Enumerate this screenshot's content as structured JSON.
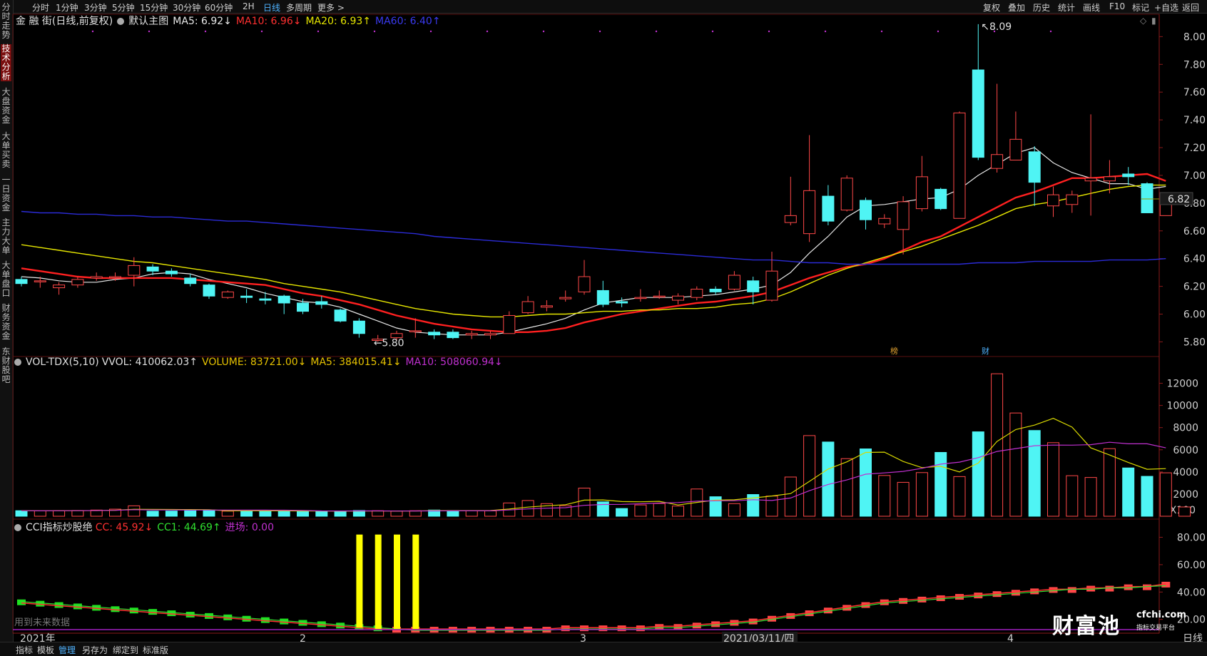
{
  "topbar": {
    "timeframes": [
      "分时",
      "1分钟",
      "3分钟",
      "5分钟",
      "15分钟",
      "30分钟",
      "60分钟",
      "2H",
      "日线",
      "多周期",
      "更多 >"
    ],
    "active_timeframe": "日线",
    "right_tools": [
      "复权",
      "叠加",
      "历史",
      "统计",
      "画线",
      "F10",
      "标记",
      "+自选",
      "返回"
    ]
  },
  "sidebar": {
    "items": [
      "分时走势",
      "技术分析",
      "大盘资金",
      "大单买卖",
      "一日资金",
      "主力大单",
      "大单盘口",
      "财务资金",
      "东财股吧"
    ],
    "active": "技术分析"
  },
  "main_header": {
    "title": "金 融 街(日线,前复权)",
    "template": "默认主图",
    "ma5": "MA5: 6.92↓",
    "ma10": "MA10: 6.96↓",
    "ma20": "MA20: 6.93↑",
    "ma60": "MA60: 6.40↑"
  },
  "vol_header": {
    "name": "VOL-TDX(5,10)",
    "vvol": "VVOL: 410062.03↑",
    "volume": "VOLUME: 83721.00↓",
    "ma5": "MA5: 384015.41↓",
    "ma10": "MA10: 508060.94↓"
  },
  "cci_header": {
    "name": "CCI指标炒股绝",
    "cc": "CC: 45.92↓",
    "cc1": "CC1: 44.69↑",
    "entry": "进场: 0.00"
  },
  "labels": {
    "high": "8.09",
    "low": "5.80",
    "last_price": "6.82",
    "unit": "X100",
    "future_note": "用到未来数据",
    "period": "日线",
    "marker_bang": "榜",
    "marker_cai": "财",
    "x_axis": [
      "2021年",
      "2",
      "3",
      "2021/03/11/四",
      "4"
    ]
  },
  "bottombar": {
    "items": [
      "指标",
      "模板",
      "管理",
      "另存为",
      "绑定到",
      "标准版"
    ],
    "active": "管理"
  },
  "watermark": {
    "brand": "财富池",
    "site": "cfchi.com",
    "tagline": "指标交易平台"
  },
  "colors": {
    "up": "#ff4848",
    "down": "#4ff4f4",
    "ma5": "#e8e8e8",
    "ma10": "#ff2020",
    "ma20": "#e6e600",
    "ma60": "#2b2bd6",
    "vol_ma5": "#d8d800",
    "vol_ma10": "#c030d0"
  },
  "chart_data": [
    {
      "type": "candlestick",
      "title": "金 融 街(日线,前复权)",
      "x_labels": [
        "2021年",
        "2",
        "3",
        "2021/03/11/四",
        "4"
      ],
      "ylim": [
        5.72,
        8.12
      ],
      "yticks": [
        5.8,
        6.0,
        6.2,
        6.4,
        6.6,
        6.8,
        7.0,
        7.2,
        7.4,
        7.6,
        7.8,
        8.0
      ],
      "candles": [
        [
          6.25,
          6.22,
          6.27,
          6.2
        ],
        [
          6.24,
          6.24,
          6.27,
          6.19
        ],
        [
          6.19,
          6.21,
          6.23,
          6.14
        ],
        [
          6.21,
          6.25,
          6.27,
          6.19
        ],
        [
          6.26,
          6.27,
          6.3,
          6.24
        ],
        [
          6.27,
          6.27,
          6.3,
          6.24
        ],
        [
          6.28,
          6.35,
          6.41,
          6.2
        ],
        [
          6.34,
          6.31,
          6.36,
          6.28
        ],
        [
          6.31,
          6.29,
          6.33,
          6.27
        ],
        [
          6.26,
          6.22,
          6.29,
          6.2
        ],
        [
          6.21,
          6.13,
          6.22,
          6.11
        ],
        [
          6.12,
          6.16,
          6.17,
          6.11
        ],
        [
          6.13,
          6.12,
          6.18,
          6.08
        ],
        [
          6.11,
          6.1,
          6.16,
          6.07
        ],
        [
          6.13,
          6.08,
          6.14,
          6.0
        ],
        [
          6.08,
          6.02,
          6.11,
          6.0
        ],
        [
          6.09,
          6.07,
          6.13,
          6.04
        ],
        [
          6.03,
          5.95,
          6.04,
          5.94
        ],
        [
          5.95,
          5.86,
          5.97,
          5.83
        ],
        [
          5.81,
          5.82,
          5.85,
          5.8
        ],
        [
          5.83,
          5.86,
          5.88,
          5.81
        ],
        [
          5.88,
          5.88,
          5.97,
          5.83
        ],
        [
          5.87,
          5.85,
          5.89,
          5.82
        ],
        [
          5.87,
          5.83,
          5.89,
          5.82
        ],
        [
          5.85,
          5.86,
          5.88,
          5.82
        ],
        [
          5.85,
          5.86,
          5.88,
          5.82
        ],
        [
          5.86,
          5.99,
          6.02,
          5.86
        ],
        [
          6.01,
          6.09,
          6.13,
          6.0
        ],
        [
          6.05,
          6.06,
          6.1,
          6.02
        ],
        [
          6.11,
          6.12,
          6.17,
          6.09
        ],
        [
          6.16,
          6.27,
          6.39,
          6.14
        ],
        [
          6.17,
          6.07,
          6.24,
          6.05
        ],
        [
          6.09,
          6.08,
          6.12,
          6.05
        ],
        [
          6.12,
          6.12,
          6.18,
          6.09
        ],
        [
          6.13,
          6.13,
          6.17,
          6.11
        ],
        [
          6.1,
          6.13,
          6.15,
          6.07
        ],
        [
          6.12,
          6.18,
          6.2,
          6.1
        ],
        [
          6.18,
          6.16,
          6.2,
          6.14
        ],
        [
          6.18,
          6.28,
          6.31,
          6.17
        ],
        [
          6.24,
          6.16,
          6.27,
          6.07
        ],
        [
          6.1,
          6.31,
          6.45,
          6.09
        ],
        [
          6.66,
          6.71,
          6.99,
          6.64
        ],
        [
          6.58,
          6.89,
          7.29,
          6.52
        ],
        [
          6.85,
          6.67,
          6.93,
          6.64
        ],
        [
          6.75,
          6.98,
          7.0,
          6.74
        ],
        [
          6.82,
          6.68,
          6.84,
          6.61
        ],
        [
          6.65,
          6.69,
          6.72,
          6.62
        ],
        [
          6.61,
          6.81,
          6.85,
          6.43
        ],
        [
          6.76,
          6.99,
          7.14,
          6.74
        ],
        [
          6.9,
          6.76,
          6.91,
          6.75
        ],
        [
          6.69,
          7.45,
          7.46,
          6.69
        ],
        [
          7.76,
          7.13,
          8.09,
          7.11
        ],
        [
          7.05,
          7.15,
          7.66,
          7.02
        ],
        [
          7.11,
          7.26,
          7.46,
          7.11
        ],
        [
          7.17,
          6.95,
          7.21,
          6.78
        ],
        [
          6.78,
          6.86,
          6.92,
          6.7
        ],
        [
          6.79,
          6.86,
          6.89,
          6.73
        ],
        [
          6.96,
          6.98,
          7.44,
          6.71
        ],
        [
          6.96,
          6.99,
          7.11,
          6.87
        ],
        [
          7.01,
          6.99,
          7.06,
          6.93
        ],
        [
          6.94,
          6.73,
          6.95,
          6.73
        ],
        [
          6.71,
          6.83,
          6.86,
          6.71
        ]
      ],
      "ma_series": [
        {
          "name": "MA5",
          "values": [
            6.27,
            6.26,
            6.24,
            6.23,
            6.23,
            6.25,
            6.26,
            6.29,
            6.3,
            6.29,
            6.25,
            6.22,
            6.19,
            6.15,
            6.12,
            6.09,
            6.08,
            6.05,
            6.0,
            5.95,
            5.9,
            5.87,
            5.86,
            5.85,
            5.85,
            5.85,
            5.87,
            5.9,
            5.93,
            5.97,
            6.03,
            6.08,
            6.1,
            6.12,
            6.12,
            6.12,
            6.13,
            6.14,
            6.16,
            6.18,
            6.21,
            6.3,
            6.44,
            6.56,
            6.7,
            6.78,
            6.79,
            6.81,
            6.83,
            6.84,
            6.9,
            7.0,
            7.08,
            7.16,
            7.2,
            7.09,
            7.02,
            6.98,
            6.94,
            6.94,
            6.9,
            6.92
          ]
        },
        {
          "name": "MA10",
          "values": [
            6.33,
            6.31,
            6.29,
            6.27,
            6.26,
            6.26,
            6.26,
            6.26,
            6.26,
            6.25,
            6.24,
            6.23,
            6.22,
            6.21,
            6.18,
            6.15,
            6.13,
            6.1,
            6.07,
            6.03,
            5.99,
            5.96,
            5.93,
            5.91,
            5.89,
            5.88,
            5.87,
            5.87,
            5.88,
            5.9,
            5.94,
            5.97,
            6.0,
            6.02,
            6.04,
            6.06,
            6.08,
            6.09,
            6.11,
            6.13,
            6.16,
            6.21,
            6.26,
            6.3,
            6.34,
            6.36,
            6.4,
            6.46,
            6.52,
            6.56,
            6.63,
            6.7,
            6.77,
            6.84,
            6.88,
            6.93,
            6.98,
            6.98,
            6.99,
            7.0,
            7.01,
            6.96
          ]
        },
        {
          "name": "MA20",
          "values": [
            6.5,
            6.48,
            6.46,
            6.44,
            6.42,
            6.4,
            6.38,
            6.37,
            6.35,
            6.33,
            6.31,
            6.29,
            6.27,
            6.25,
            6.22,
            6.2,
            6.18,
            6.16,
            6.13,
            6.1,
            6.07,
            6.04,
            6.02,
            6.0,
            5.99,
            5.98,
            5.98,
            5.99,
            6.0,
            6.0,
            6.01,
            6.02,
            6.02,
            6.03,
            6.03,
            6.04,
            6.04,
            6.05,
            6.07,
            6.08,
            6.11,
            6.16,
            6.22,
            6.28,
            6.33,
            6.37,
            6.41,
            6.45,
            6.49,
            6.54,
            6.59,
            6.64,
            6.7,
            6.76,
            6.79,
            6.81,
            6.84,
            6.87,
            6.9,
            6.92,
            6.93,
            6.93
          ]
        },
        {
          "name": "MA60",
          "values": [
            6.74,
            6.73,
            6.73,
            6.72,
            6.72,
            6.71,
            6.71,
            6.7,
            6.7,
            6.69,
            6.68,
            6.67,
            6.67,
            6.66,
            6.65,
            6.64,
            6.63,
            6.62,
            6.61,
            6.6,
            6.59,
            6.58,
            6.56,
            6.55,
            6.54,
            6.53,
            6.52,
            6.51,
            6.5,
            6.49,
            6.48,
            6.47,
            6.46,
            6.45,
            6.44,
            6.43,
            6.42,
            6.41,
            6.4,
            6.39,
            6.39,
            6.38,
            6.37,
            6.37,
            6.36,
            6.36,
            6.36,
            6.36,
            6.36,
            6.36,
            6.36,
            6.37,
            6.37,
            6.37,
            6.38,
            6.38,
            6.38,
            6.38,
            6.39,
            6.39,
            6.39,
            6.4
          ]
        }
      ]
    },
    {
      "type": "bar",
      "title": "VOL-TDX(5,10)",
      "ylabel": "X100",
      "ylim": [
        0,
        13000
      ],
      "yticks": [
        2000,
        4000,
        6000,
        8000,
        10000,
        12000
      ],
      "volumes": [
        500,
        480,
        500,
        520,
        560,
        640,
        940,
        460,
        470,
        500,
        560,
        460,
        480,
        460,
        500,
        460,
        480,
        400,
        520,
        500,
        460,
        500,
        560,
        520,
        500,
        480,
        1200,
        1420,
        1140,
        960,
        2540,
        1300,
        700,
        1020,
        1150,
        920,
        2460,
        1760,
        1140,
        1960,
        1820,
        3540,
        7280,
        6700,
        5200,
        6080,
        3680,
        3060,
        3940,
        5760,
        3580,
        7620,
        12860,
        9320,
        7740,
        6640,
        3660,
        3500,
        6100,
        4360,
        3600,
        3920,
        837
      ]
    },
    {
      "type": "line",
      "title": "CCI指标炒股绝",
      "ylim": [
        12,
        86
      ],
      "yticks": [
        20.0,
        40.0,
        60.0,
        80.0
      ],
      "series": [
        {
          "name": "CC",
          "values": [
            32,
            31,
            30,
            29,
            28,
            27,
            26,
            25,
            24,
            23,
            22,
            21,
            20,
            19,
            18,
            17,
            16,
            15,
            14,
            13,
            13,
            13,
            13,
            13,
            13,
            13,
            13,
            13,
            13,
            14,
            14,
            14,
            14,
            14,
            15,
            15,
            16,
            17,
            18,
            19,
            21,
            23,
            25,
            27,
            29,
            31,
            33,
            34,
            35,
            36,
            37,
            38,
            39,
            40,
            41,
            42,
            42,
            43,
            43,
            44,
            44,
            45.92
          ]
        },
        {
          "name": "CC1",
          "values": [
            33,
            32,
            31,
            30,
            29,
            28,
            27,
            26,
            25,
            24,
            23,
            22,
            21,
            20,
            19,
            18,
            17,
            16,
            15,
            14,
            13,
            12,
            12,
            12,
            12,
            12,
            12,
            12,
            12,
            13,
            13,
            13,
            13,
            13,
            14,
            14,
            15,
            16,
            17,
            18,
            20,
            22,
            24,
            26,
            28,
            30,
            32,
            33,
            34,
            35,
            36,
            37,
            38,
            39,
            40,
            41,
            42,
            42,
            43,
            43,
            44,
            44.69
          ]
        }
      ],
      "entry_signals": [
        18,
        19,
        20,
        21
      ]
    }
  ]
}
